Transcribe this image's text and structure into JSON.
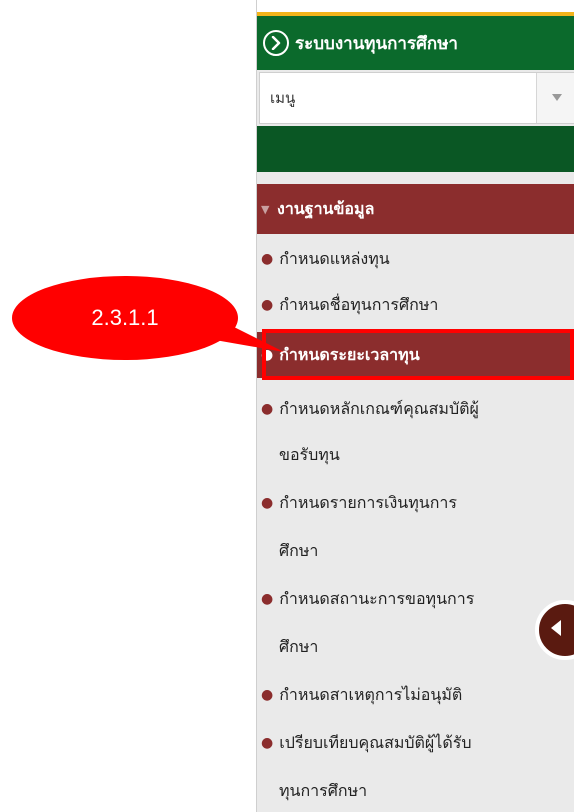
{
  "header": {
    "title": "ระบบงานทุนการศึกษา",
    "icon": "chevron-right-circle-icon"
  },
  "menu_select": {
    "value": "เมนู"
  },
  "section": {
    "title": "งานฐานข้อมูล"
  },
  "menu_items": [
    {
      "label": "กำหนดแหล่งทุน"
    },
    {
      "label": "กำหนดชื่อทุนการศึกษา"
    },
    {
      "label": "กำหนดระยะเวลาทุน",
      "active": true
    },
    {
      "label": "กำหนดหลักเกณฑ์คุณสมบัติผู้",
      "cont": "ขอรับทุน"
    },
    {
      "label": "กำหนดรายการเงินทุนการ",
      "cont": "ศึกษา"
    },
    {
      "label": "กำหนดสถานะการขอทุนการ",
      "cont": "ศึกษา"
    },
    {
      "label": "กำหนดสาเหตุการไม่อนุมัติ"
    },
    {
      "label": "เปรียบเทียบคุณสมบัติผู้ได้รับ",
      "cont": "ทุนการศึกษา"
    }
  ],
  "annotation": {
    "label": "2.3.1.1",
    "color": "#ff0000"
  },
  "colors": {
    "header_green": "#0b6a2c",
    "section_red": "#8b2d2d",
    "accent_yellow": "#f3b41b"
  }
}
